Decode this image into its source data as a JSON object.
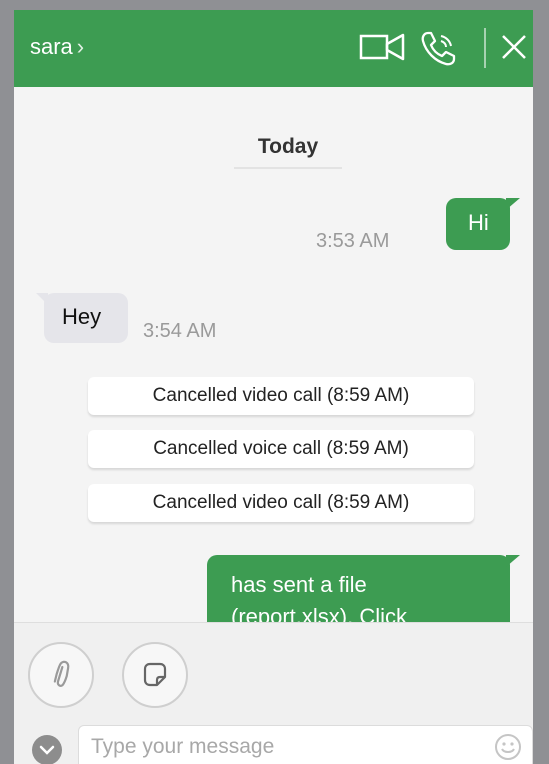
{
  "header": {
    "contact_name": "sara",
    "chevron": "›",
    "icons": [
      "video-call-icon",
      "voice-call-icon",
      "close-icon"
    ],
    "color": "#3d9c52"
  },
  "messages": {
    "date_separator": "Today",
    "items": [
      {
        "type": "outgoing",
        "text": "Hi",
        "time": "3:53 AM"
      },
      {
        "type": "incoming",
        "text": "Hey",
        "time": "3:54 AM"
      },
      {
        "type": "system",
        "text": "Cancelled video call (8:59 AM)"
      },
      {
        "type": "system",
        "text": "Cancelled voice call (8:59 AM)"
      },
      {
        "type": "system",
        "text": "Cancelled video call (8:59 AM)"
      },
      {
        "type": "outgoing",
        "text": "has sent a file (report.xlsx). Click"
      }
    ]
  },
  "composer": {
    "attach_icon": "paperclip-icon",
    "sticker_icon": "sticker-icon",
    "expand_icon": "chevron-down-icon",
    "placeholder": "Type your message",
    "emoji_icon": "smiley-icon"
  }
}
